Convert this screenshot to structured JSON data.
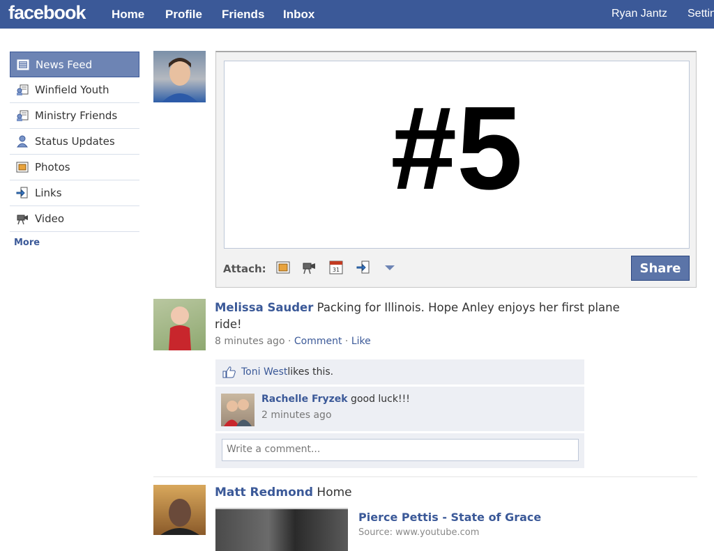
{
  "topbar": {
    "logo": "facebook",
    "nav": [
      "Home",
      "Profile",
      "Friends",
      "Inbox"
    ],
    "user_name": "Ryan Jantz",
    "settings": "Settin"
  },
  "sidebar": {
    "items": [
      {
        "label": "News Feed",
        "icon": "news-feed-icon"
      },
      {
        "label": "Winfield Youth",
        "icon": "group-list-icon"
      },
      {
        "label": "Ministry Friends",
        "icon": "group-list-icon"
      },
      {
        "label": "Status Updates",
        "icon": "person-icon"
      },
      {
        "label": "Photos",
        "icon": "photo-icon"
      },
      {
        "label": "Links",
        "icon": "link-icon"
      },
      {
        "label": "Video",
        "icon": "video-camera-icon"
      }
    ],
    "more": "More"
  },
  "composer": {
    "big_text": "#5",
    "attach_label": "Attach:",
    "attach_icons": [
      "photo-icon",
      "video-camera-icon",
      "event-calendar-icon",
      "link-icon",
      "dropdown-arrow-icon"
    ],
    "calendar_day": "31",
    "share_label": "Share"
  },
  "story1": {
    "author": "Melissa Sauder",
    "text": " Packing for Illinois. Hope Anley enjoys her first plane ride!",
    "time": "8 minutes ago",
    "comment_link": "Comment",
    "like_link": "Like",
    "liker": "Toni West",
    "likes_text": " likes this.",
    "comment": {
      "author": "Rachelle Fryzek",
      "text": " good luck!!!",
      "time": "2 minutes ago"
    },
    "write_placeholder": "Write a comment..."
  },
  "story2": {
    "author": "Matt Redmond",
    "text": " Home",
    "video_title": "Pierce Pettis - State of Grace",
    "video_source": "Source: www.youtube.com"
  },
  "colors": {
    "brand": "#3b5998",
    "sidebar_active": "#6d84b4",
    "ufi_bg": "#edeff4"
  }
}
